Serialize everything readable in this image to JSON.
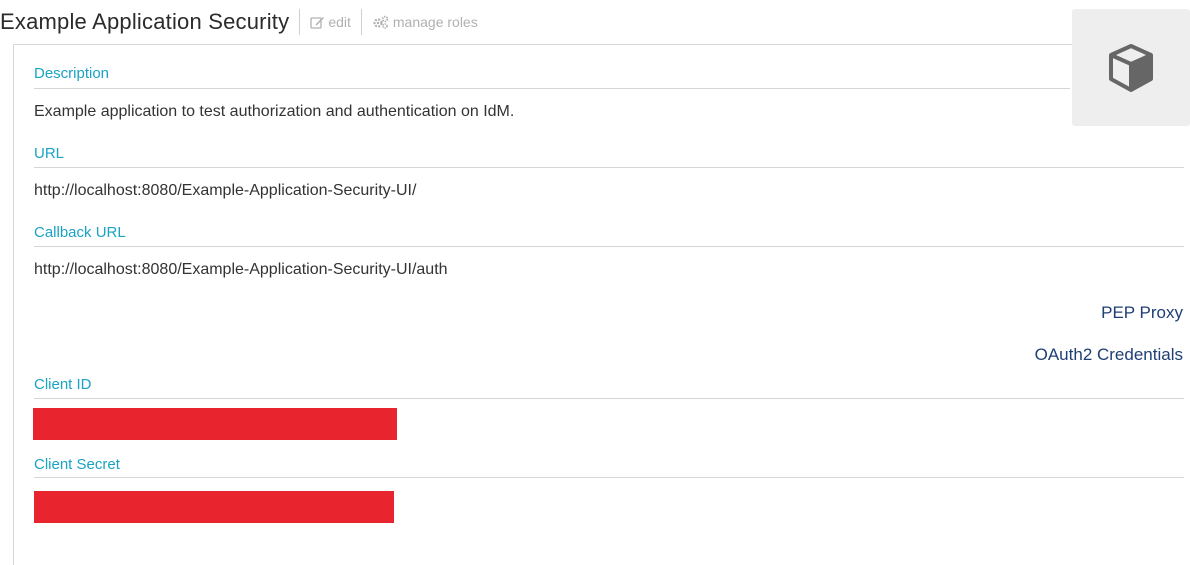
{
  "header": {
    "title": "Example Application Security",
    "edit_label": "edit",
    "manage_roles_label": "manage roles"
  },
  "icons": {
    "edit": "edit-icon",
    "manage_roles": "gears-icon",
    "app_avatar": "cube-icon"
  },
  "fields": {
    "description": {
      "label": "Description",
      "value": "Example application to test authorization and authentication on IdM."
    },
    "url": {
      "label": "URL",
      "value": "http://localhost:8080/Example-Application-Security-UI/"
    },
    "callback_url": {
      "label": "Callback URL",
      "value": "http://localhost:8080/Example-Application-Security-UI/auth"
    }
  },
  "links": {
    "pep_proxy": "PEP Proxy",
    "oauth2_credentials": "OAuth2 Credentials"
  },
  "credentials": {
    "client_id_label": "Client ID",
    "client_secret_label": "Client Secret",
    "redaction_color": "#e8242f"
  },
  "colors": {
    "label": "#1aa3c3",
    "link": "#1f3f74",
    "muted": "#b0b0b0"
  }
}
